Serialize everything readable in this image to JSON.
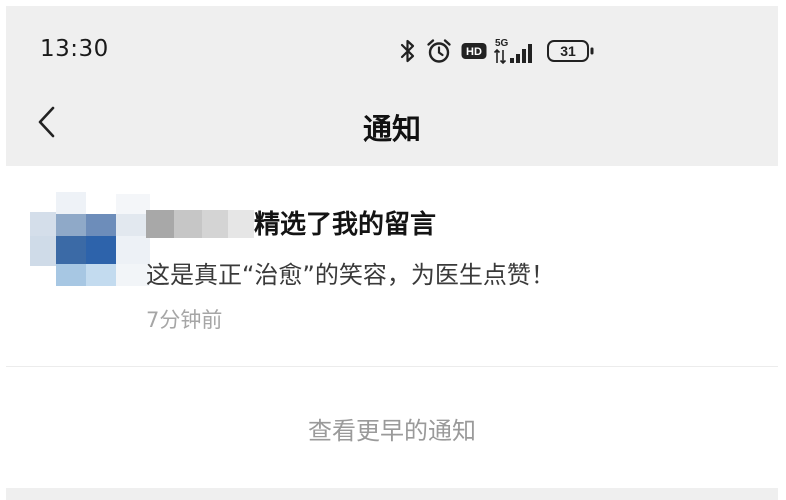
{
  "status_bar": {
    "time": "13:30",
    "network": "5G",
    "battery_level": "31",
    "icons": [
      "bluetooth-icon",
      "alarm-icon",
      "hd-icon",
      "signal-icon",
      "battery-icon"
    ]
  },
  "nav": {
    "title": "通知",
    "back_icon": "chevron-left-icon"
  },
  "notification": {
    "title": "精选了我的留言",
    "message": "这是真正“治愈”的笑容，为医生点赞！",
    "time": "7分钟前"
  },
  "footer": {
    "earlier_label": "查看更早的通知"
  },
  "colors": {
    "header_bg": "#efefef",
    "title": "#141414",
    "secondary_text": "#a6a6a6",
    "avatar_accent": "#3a6fae"
  }
}
